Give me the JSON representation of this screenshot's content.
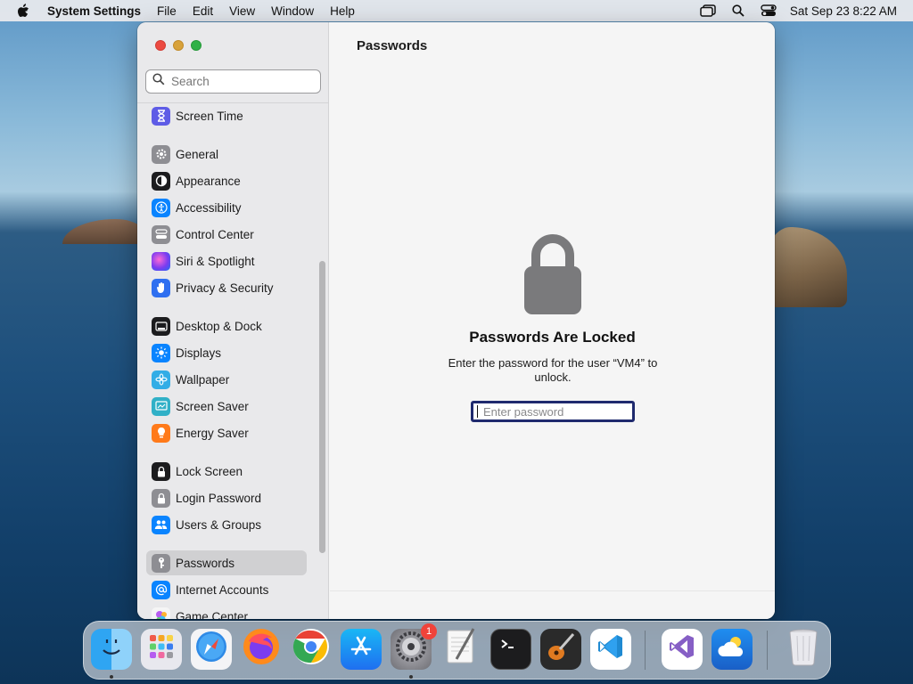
{
  "menubar": {
    "app_name": "System Settings",
    "menus": [
      "File",
      "Edit",
      "View",
      "Window",
      "Help"
    ],
    "clock": "Sat Sep 23  8:22 AM"
  },
  "sidebar": {
    "search_placeholder": "Search",
    "items": [
      {
        "label": "Screen Time",
        "icon": "hourglass-icon",
        "color": "#5e5ce6"
      },
      {
        "label": "General",
        "icon": "gear-icon",
        "color": "#8e8e93"
      },
      {
        "label": "Appearance",
        "icon": "appearance-icon",
        "color": "#1c1c1e"
      },
      {
        "label": "Accessibility",
        "icon": "accessibility-icon",
        "color": "#0a84ff"
      },
      {
        "label": "Control Center",
        "icon": "control-center-icon",
        "color": "#8e8e93"
      },
      {
        "label": "Siri & Spotlight",
        "icon": "siri-icon",
        "color": "#bf5af2"
      },
      {
        "label": "Privacy & Security",
        "icon": "hand-icon",
        "color": "#2f6ff0"
      },
      {
        "label": "Desktop & Dock",
        "icon": "dock-icon",
        "color": "#1c1c1e"
      },
      {
        "label": "Displays",
        "icon": "sun-icon",
        "color": "#0a84ff"
      },
      {
        "label": "Wallpaper",
        "icon": "flower-icon",
        "color": "#32ade6"
      },
      {
        "label": "Screen Saver",
        "icon": "screen-saver-icon",
        "color": "#30b0c7"
      },
      {
        "label": "Energy Saver",
        "icon": "bulb-icon",
        "color": "#ff7a1a"
      },
      {
        "label": "Lock Screen",
        "icon": "lock-icon",
        "color": "#1c1c1e"
      },
      {
        "label": "Login Password",
        "icon": "lock-icon",
        "color": "#8e8e93"
      },
      {
        "label": "Users & Groups",
        "icon": "users-icon",
        "color": "#0a84ff"
      },
      {
        "label": "Passwords",
        "icon": "key-icon",
        "color": "#8e8e93"
      },
      {
        "label": "Internet Accounts",
        "icon": "at-icon",
        "color": "#0a84ff"
      },
      {
        "label": "Game Center",
        "icon": "game-center-icon",
        "color": "#ffffff"
      }
    ],
    "selected": "Passwords"
  },
  "main": {
    "title": "Passwords",
    "locked_title": "Passwords Are Locked",
    "locked_description": "Enter the password for the user “VM4” to unlock.",
    "password_placeholder": "Enter password"
  },
  "dock": {
    "apps": [
      {
        "name": "Finder",
        "icon": "finder-icon",
        "color": "#3aa0f0",
        "running": true
      },
      {
        "name": "Launchpad",
        "icon": "launchpad-icon",
        "color": "#e8e8ee",
        "running": false
      },
      {
        "name": "Safari",
        "icon": "safari-icon",
        "color": "#2f8ae6",
        "running": false
      },
      {
        "name": "Firefox",
        "icon": "firefox-icon",
        "color": "#ff6b2c",
        "running": false
      },
      {
        "name": "Chrome",
        "icon": "chrome-icon",
        "color": "#ffffff",
        "running": false
      },
      {
        "name": "App Store",
        "icon": "app-store-icon",
        "color": "#1e8ef0",
        "running": false
      },
      {
        "name": "System Settings",
        "icon": "system-settings-icon",
        "color": "#8e8e93",
        "running": true,
        "badge": "1"
      },
      {
        "name": "TextEdit",
        "icon": "textedit-icon",
        "color": "#f2f2f2",
        "running": false
      },
      {
        "name": "Terminal",
        "icon": "terminal-icon",
        "color": "#1c1c1c",
        "running": false
      },
      {
        "name": "GarageBand",
        "icon": "guitar-icon",
        "color": "#d86a1d",
        "running": false
      },
      {
        "name": "Visual Studio Code",
        "icon": "vscode-icon",
        "color": "#ffffff",
        "running": false
      },
      {
        "name": "Visual Studio",
        "icon": "visual-studio-icon",
        "color": "#ffffff",
        "running": false
      },
      {
        "name": "Weather",
        "icon": "weather-icon",
        "color": "#1e7fe0",
        "running": false
      },
      {
        "name": "Trash",
        "icon": "trash-icon",
        "color": "#e6e6ea",
        "running": false
      }
    ]
  }
}
